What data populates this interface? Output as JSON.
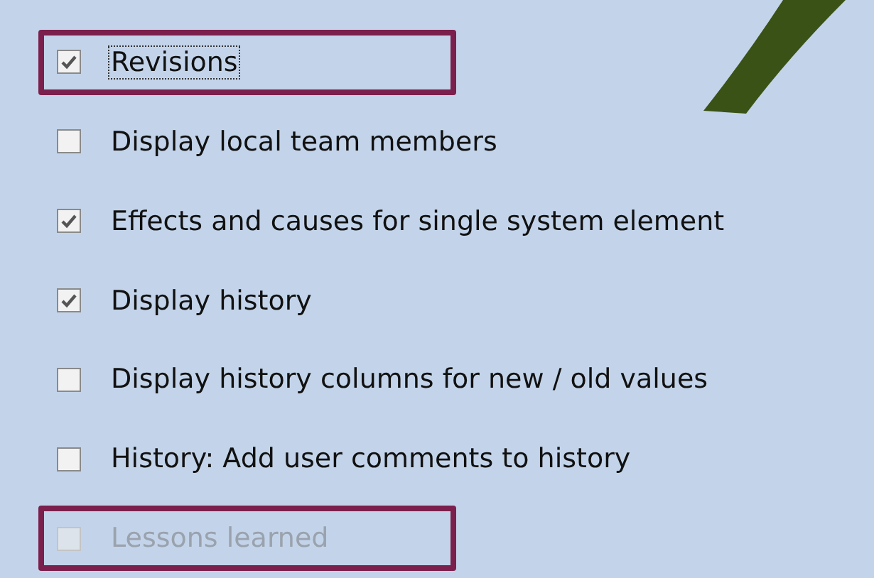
{
  "options": [
    {
      "label": "Revisions",
      "checked": true,
      "disabled": false,
      "focused": true,
      "highlighted": true
    },
    {
      "label": "Display local team members",
      "checked": false,
      "disabled": false,
      "focused": false,
      "highlighted": false
    },
    {
      "label": "Effects and causes for single system element",
      "checked": true,
      "disabled": false,
      "focused": false,
      "highlighted": false
    },
    {
      "label": "Display history",
      "checked": true,
      "disabled": false,
      "focused": false,
      "highlighted": false
    },
    {
      "label": "Display history columns for new / old values",
      "checked": false,
      "disabled": false,
      "focused": false,
      "highlighted": false
    },
    {
      "label": "History: Add user comments to history",
      "checked": false,
      "disabled": false,
      "focused": false,
      "highlighted": false
    },
    {
      "label": "Lessons learned",
      "checked": false,
      "disabled": true,
      "focused": false,
      "highlighted": true
    }
  ]
}
